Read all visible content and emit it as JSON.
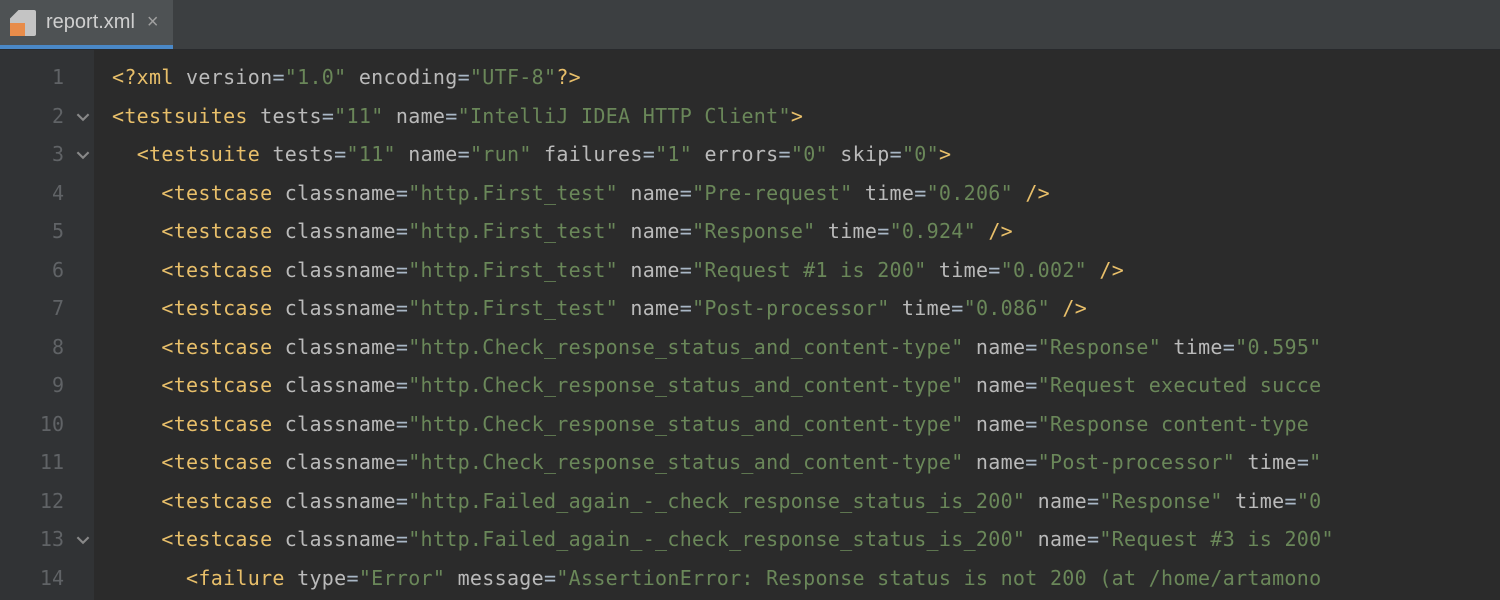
{
  "tab": {
    "filename": "report.xml"
  },
  "gutter": {
    "lines": [
      "1",
      "2",
      "3",
      "4",
      "5",
      "6",
      "7",
      "8",
      "9",
      "10",
      "11",
      "12",
      "13",
      "14"
    ]
  },
  "fold_marks": [
    {
      "line": 2,
      "dir": "down"
    },
    {
      "line": 3,
      "dir": "down"
    },
    {
      "line": 13,
      "dir": "down"
    }
  ],
  "xml": {
    "prolog": {
      "version": "1.0",
      "encoding": "UTF-8"
    },
    "root": {
      "tag": "testsuites",
      "attrs": {
        "tests": "11",
        "name": "IntelliJ IDEA HTTP Client"
      }
    },
    "suite": {
      "tag": "testsuite",
      "attrs": {
        "tests": "11",
        "name": "run",
        "failures": "1",
        "errors": "0",
        "skip": "0"
      }
    },
    "cases": [
      {
        "classname": "http.First_test",
        "name": "Pre-request",
        "time": "0.206",
        "self_close": true
      },
      {
        "classname": "http.First_test",
        "name": "Response",
        "time": "0.924",
        "self_close": true
      },
      {
        "classname": "http.First_test",
        "name": "Request #1 is 200",
        "time": "0.002",
        "self_close": true
      },
      {
        "classname": "http.First_test",
        "name": "Post-processor",
        "time": "0.086",
        "self_close": true
      },
      {
        "classname": "http.Check_response_status_and_content-type",
        "name": "Response",
        "time": "0.595",
        "truncated_after_time_value": true
      },
      {
        "classname": "http.Check_response_status_and_content-type",
        "name": "Request executed succe",
        "truncated_after_name": true
      },
      {
        "classname": "http.Check_response_status_and_content-type",
        "name": "Response content-type ",
        "truncated_after_name": true
      },
      {
        "classname": "http.Check_response_status_and_content-type",
        "name": "Post-processor",
        "time_truncated": true
      },
      {
        "classname": "http.Failed_again_-_check_response_status_is_200",
        "name": "Response",
        "time_value_truncated": "0"
      },
      {
        "classname": "http.Failed_again_-_check_response_status_is_200",
        "name": "Request #3 is 200",
        "truncated_after_name_no_close": true
      }
    ],
    "failure": {
      "type": "Error",
      "message": "AssertionError: Response status is not 200 (at /home/artamono"
    }
  },
  "indents": {
    "l1": "",
    "l2": "  ",
    "l3": "    ",
    "l4": "      "
  }
}
